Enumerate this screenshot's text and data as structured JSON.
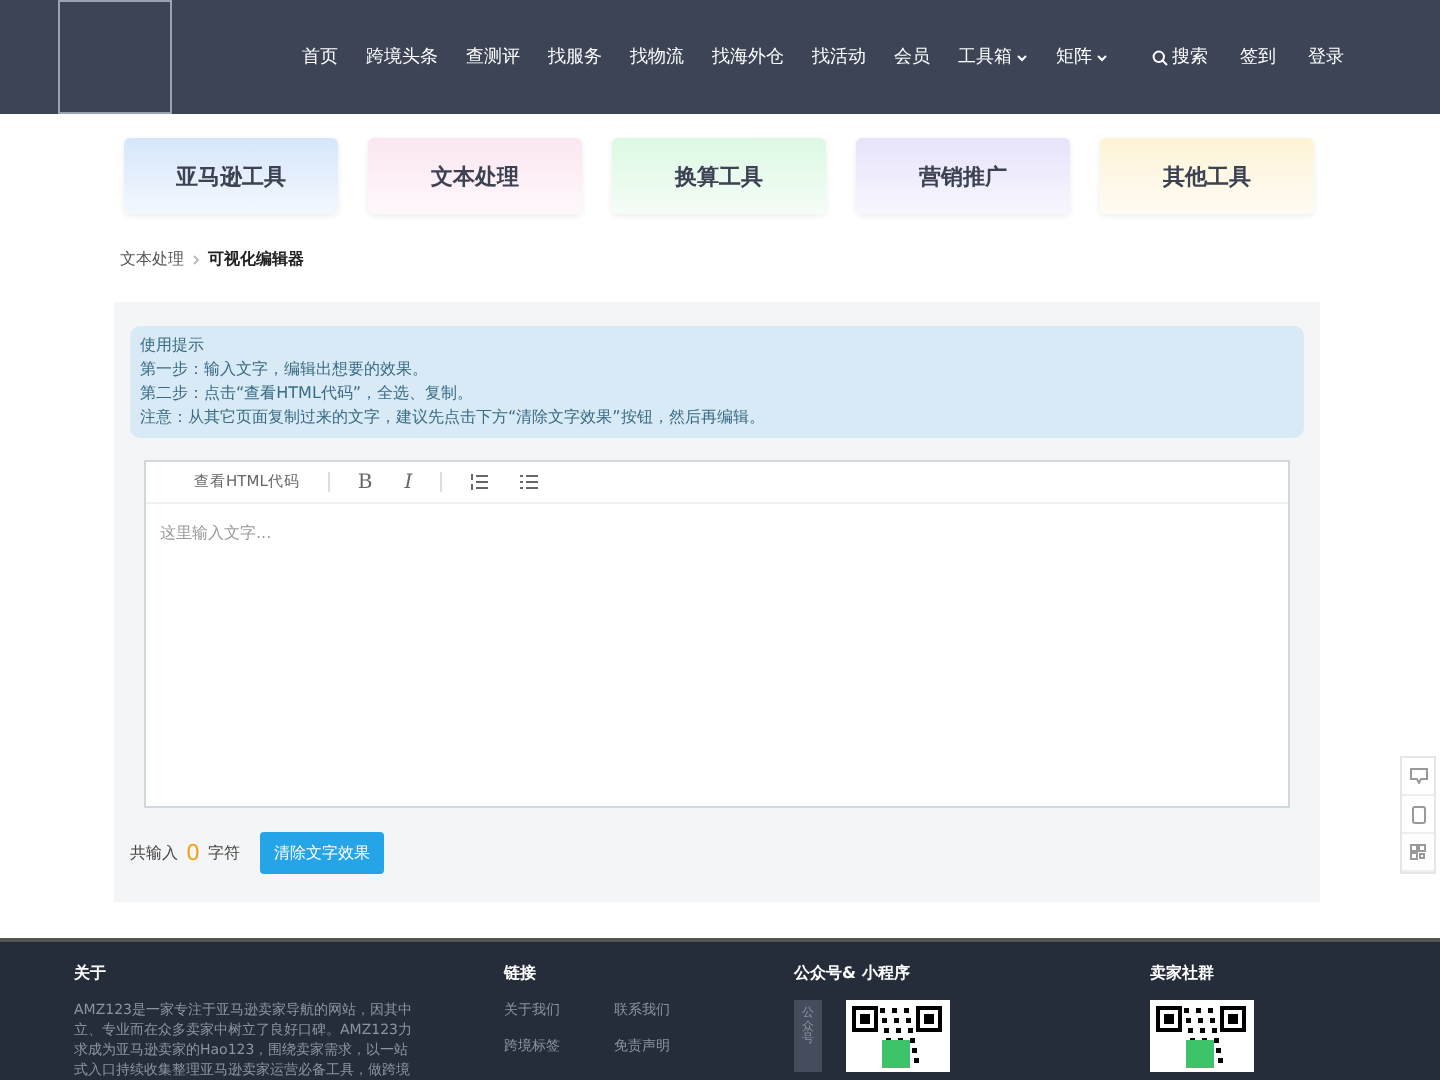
{
  "header": {
    "nav": [
      {
        "label": "首页",
        "dropdown": false
      },
      {
        "label": "跨境头条",
        "dropdown": false
      },
      {
        "label": "查测评",
        "dropdown": false
      },
      {
        "label": "找服务",
        "dropdown": false
      },
      {
        "label": "找物流",
        "dropdown": false
      },
      {
        "label": "找海外仓",
        "dropdown": false
      },
      {
        "label": "找活动",
        "dropdown": false
      },
      {
        "label": "会员",
        "dropdown": false
      },
      {
        "label": "工具箱",
        "dropdown": true
      },
      {
        "label": "矩阵",
        "dropdown": true
      }
    ],
    "search": "搜索",
    "checkin": "签到",
    "login": "登录"
  },
  "categories": [
    {
      "label": "亚马逊工具",
      "color": "#d6e6fb"
    },
    {
      "label": "文本处理",
      "color": "#fbe6f1"
    },
    {
      "label": "换算工具",
      "color": "#dcf8e3"
    },
    {
      "label": "营销推广",
      "color": "#e6e3fb"
    },
    {
      "label": "其他工具",
      "color": "#fdf3d6"
    }
  ],
  "breadcrumb": [
    "文本处理",
    "可视化编辑器"
  ],
  "tips": [
    "使用提示",
    "第一步：输入文字，编辑出想要的效果。",
    "第二步：点击“查看HTML代码”，全选、复制。",
    "注意：从其它页面复制过来的文字，建议先点击下方“清除文字效果”按钮，然后再编辑。"
  ],
  "editor": {
    "toolbar": {
      "html_button": "查看HTML代码",
      "bold": "B",
      "italic": "I"
    },
    "placeholder": "这里输入文字..."
  },
  "counter": {
    "prefix": "共输入",
    "count": "0",
    "suffix": "字符"
  },
  "clear_button": "清除文字效果",
  "footer": {
    "about": {
      "title": "关于",
      "text": "AMZ123是一家专注于亚马逊卖家导航的网站，因其中立、专业而在众多卖家中树立了良好口碑。AMZ123力求成为亚马逊卖家的Hao123，围绕卖家需求，以一站式入口持续收集整理亚马逊卖家运营必备工具，做跨境"
    },
    "links": {
      "title": "链接",
      "items": [
        "关于我们",
        "联系我们",
        "跨境标签",
        "免责声明"
      ]
    },
    "wechat": {
      "title": "公众号& 小程序",
      "tab": "公众号"
    },
    "community": {
      "title": "卖家社群"
    }
  }
}
